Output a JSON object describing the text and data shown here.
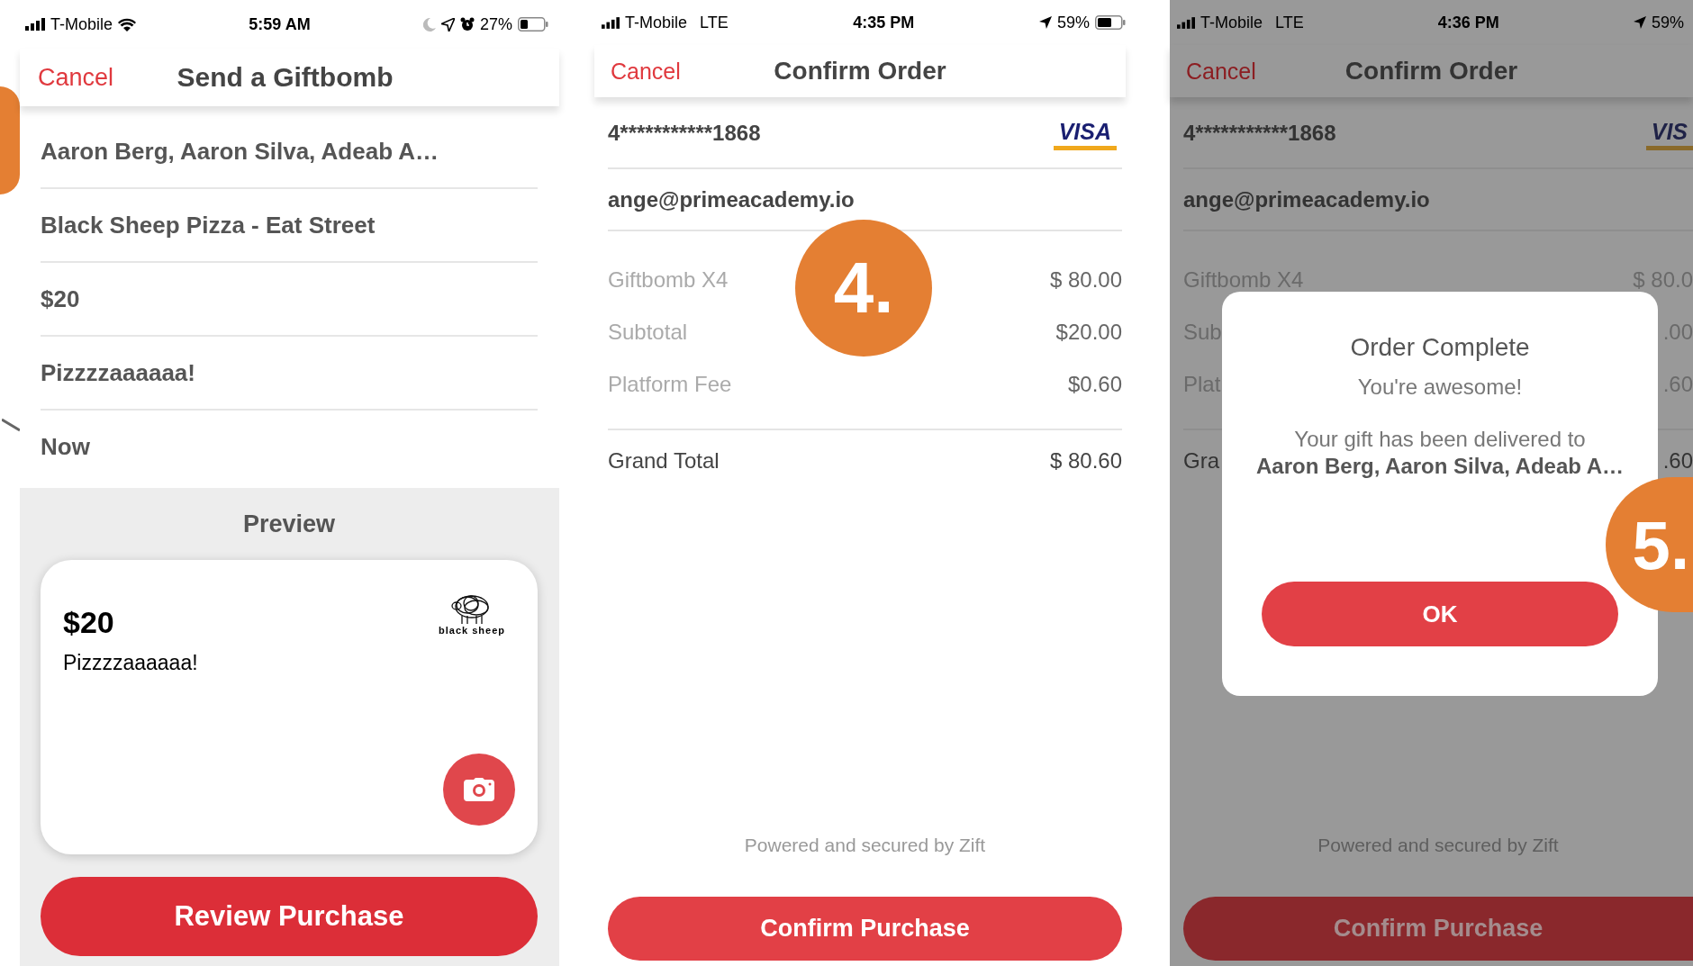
{
  "send_screen": {
    "status_bar": {
      "carrier": "T-Mobile",
      "time": "5:59 AM",
      "battery": "27%"
    },
    "nav": {
      "cancel": "Cancel",
      "title": "Send a Giftbomb"
    },
    "fields": [
      "Aaron Berg, Aaron Silva, Adeab A…",
      "Black Sheep Pizza - Eat Street",
      "$20",
      "Pizzzzaaaaaa!",
      "Now"
    ],
    "preview": {
      "heading": "Preview",
      "amount": "$20",
      "message": "Pizzzzaaaaaa!",
      "logo_text": "black sheep"
    },
    "button": "Review Purchase"
  },
  "order_screens": [
    {
      "dimmed": false,
      "status_bar": {
        "carrier": "T-Mobile",
        "network": "LTE",
        "time": "4:35 PM",
        "battery": "59%"
      },
      "nav": {
        "cancel": "Cancel",
        "title": "Confirm Order"
      },
      "card_number": "4***********1868",
      "card_brand": "VISA",
      "email": "ange@primeacademy.io",
      "lines": [
        {
          "label": "Giftbomb X4",
          "value": "$ 80.00"
        },
        {
          "label": "Subtotal",
          "value": "$20.00"
        },
        {
          "label": "Platform Fee",
          "value": "$0.60"
        }
      ],
      "total": {
        "label": "Grand Total",
        "value": "$ 80.60"
      },
      "footer": "Powered and secured by Zift",
      "button": "Confirm Purchase",
      "step_badge": "4."
    },
    {
      "dimmed": true,
      "status_bar": {
        "carrier": "T-Mobile",
        "network": "LTE",
        "time": "4:36 PM",
        "battery": "59%"
      },
      "nav": {
        "cancel": "Cancel",
        "title": "Confirm Order"
      },
      "card_number": "4***********1868",
      "card_brand": "VIS",
      "email": "ange@primeacademy.io",
      "lines": [
        {
          "label": "Giftbomb X4",
          "value": "$ 80.0"
        },
        {
          "label": "Sub",
          "value": ".00"
        },
        {
          "label": "Plat",
          "value": ".60"
        }
      ],
      "total": {
        "label": "Gra",
        "value": ".60"
      },
      "footer": "Powered and secured by Zift",
      "button": "Confirm Purchase",
      "dialog": {
        "title": "Order Complete",
        "subtitle": "You're awesome!",
        "message": "Your gift has been delivered to",
        "recipients": "Aaron Berg, Aaron Silva, Adeab A…",
        "button": "OK"
      },
      "step_badge": "5."
    }
  ]
}
